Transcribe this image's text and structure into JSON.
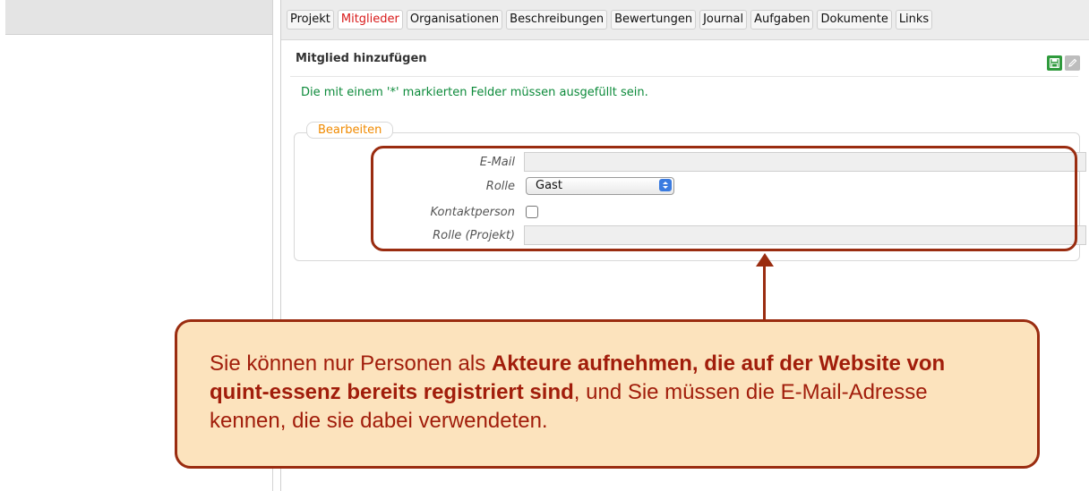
{
  "tabs": [
    "Projekt",
    "Mitglieder",
    "Organisationen",
    "Beschreibungen",
    "Bewertungen",
    "Journal",
    "Aufgaben",
    "Dokumente",
    "Links"
  ],
  "active_tab": "Mitglieder",
  "section_title": "Mitglied hinzufügen",
  "actions": {
    "save_icon": "save-icon",
    "edit_icon": "pencil-icon"
  },
  "required_note": "Die mit einem '*' markierten Felder müssen ausgefüllt sein.",
  "fieldset_legend": "Bearbeiten",
  "fields": {
    "email_label": "E-Mail",
    "email_value": "",
    "role_label": "Rolle",
    "role_value": "Gast",
    "contact_label": "Kontaktperson",
    "project_role_label": "Rolle (Projekt)",
    "project_role_value": ""
  },
  "callout": {
    "part1": "Sie können nur Personen als ",
    "bold": "Akteure aufnehmen, die auf der Website von quint-essenz bereits registriert sind",
    "part2": ", und Sie müssen die E-Mail-Adresse kennen, die sie dabei verwendeten."
  },
  "colors": {
    "accent_red": "#d81a1a",
    "callout_border": "#9a2c10",
    "callout_bg": "#fce3bd",
    "note_green": "#0c8a3a",
    "legend_orange": "#f08a00"
  }
}
